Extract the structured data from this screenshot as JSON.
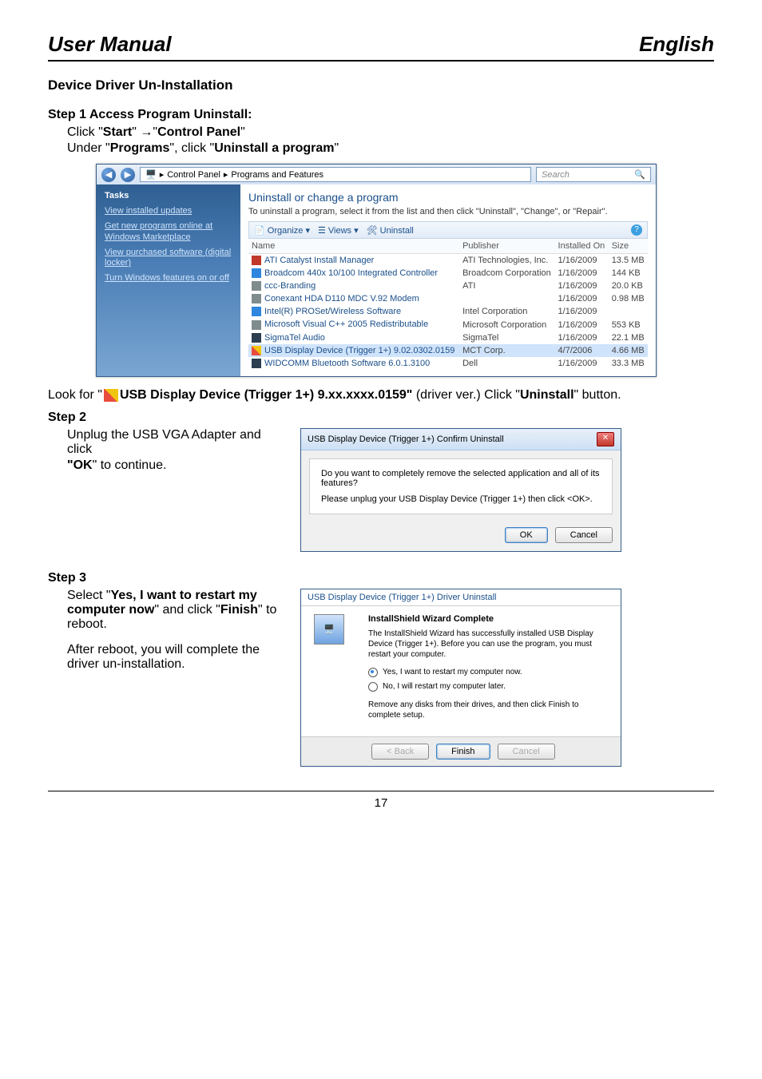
{
  "header": {
    "title": "User Manual",
    "lang": "English"
  },
  "section": {
    "title": "Device Driver Un-Installation"
  },
  "step1": {
    "title": "Step 1   Access Program Uninstall",
    "line1_pre": "Click \"",
    "start": "Start",
    "arrow": "\" →\"",
    "cp": "Control Panel",
    "quote": "\"",
    "line2_pre": "Under \"",
    "programs": "Programs",
    "line2_mid": "\", click \"",
    "uninstall_prog": "Uninstall a program",
    "line2_post": "\""
  },
  "cp_window": {
    "breadcrumb1": "Control Panel",
    "breadcrumb2": "Programs and Features",
    "search_placeholder": "Search",
    "sidebar": {
      "tasks": "Tasks",
      "views": "View installed updates",
      "getnew": "Get new programs online at Windows Marketplace",
      "purchased": "View purchased software (digital locker)",
      "turn": "Turn Windows features on or off"
    },
    "heading": "Uninstall or change a program",
    "sub": "To uninstall a program, select it from the list and then click \"Uninstall\", \"Change\", or \"Repair\".",
    "toolbar": {
      "organize": "Organize",
      "views": "Views",
      "uninstall": "Uninstall"
    },
    "cols": {
      "name": "Name",
      "publisher": "Publisher",
      "installed": "Installed On",
      "size": "Size"
    },
    "rows": [
      {
        "name": "ATI Catalyst Install Manager",
        "pub": "ATI Technologies, Inc.",
        "date": "1/16/2009",
        "size": "13.5 MB",
        "icon": "ico-red"
      },
      {
        "name": "Broadcom 440x 10/100 Integrated Controller",
        "pub": "Broadcom Corporation",
        "date": "1/16/2009",
        "size": "144 KB",
        "icon": "ico-blue"
      },
      {
        "name": "ccc-Branding",
        "pub": "ATI",
        "date": "1/16/2009",
        "size": "20.0 KB",
        "icon": "ico-gray"
      },
      {
        "name": "Conexant HDA D110 MDC V.92 Modem",
        "pub": "",
        "date": "1/16/2009",
        "size": "0.98 MB",
        "icon": "ico-gray"
      },
      {
        "name": "Intel(R) PROSet/Wireless Software",
        "pub": "Intel Corporation",
        "date": "1/16/2009",
        "size": "",
        "icon": "ico-blue"
      },
      {
        "name": "Microsoft Visual C++ 2005 Redistributable",
        "pub": "Microsoft Corporation",
        "date": "1/16/2009",
        "size": "553 KB",
        "icon": "ico-gray"
      },
      {
        "name": "SigmaTel Audio",
        "pub": "SigmaTel",
        "date": "1/16/2009",
        "size": "22.1 MB",
        "icon": "ico-bt"
      },
      {
        "name": "USB Display Device (Trigger 1+) 9.02.0302.0159",
        "pub": "MCT Corp.",
        "date": "4/7/2006",
        "size": "4.66 MB",
        "icon": "ico-usb",
        "sel": true
      },
      {
        "name": "WIDCOMM Bluetooth Software 6.0.1.3100",
        "pub": "Dell",
        "date": "1/16/2009",
        "size": "33.3 MB",
        "icon": "ico-bt"
      }
    ]
  },
  "lookfor": {
    "pre": "Look for \"",
    "bold1": "USB Display Device (Trigger 1+) 9.xx.xxxx.0159\"",
    "mid": " (driver ver.)   Click \"",
    "bold2": "Uninstall",
    "post": "\" button."
  },
  "step2": {
    "title": "Step 2",
    "line1": "Unplug the USB VGA Adapter and click",
    "ok_pre": "\"OK",
    "ok_post": "\" to continue."
  },
  "confirm_dialog": {
    "title": "USB Display Device (Trigger 1+) Confirm Uninstall",
    "line1": "Do you want to completely remove the selected application and all of its features?",
    "line2": "Please unplug your USB Display Device (Trigger 1+) then click <OK>.",
    "ok": "OK",
    "cancel": "Cancel"
  },
  "step3": {
    "title": "Step 3",
    "line1_pre": "Select \"",
    "bold1": "Yes, I want to restart my computer now",
    "line1_mid": "\" and click \"",
    "bold2": "Finish",
    "line1_post": "\" to reboot.",
    "line2": "After reboot, you will complete the driver un-installation."
  },
  "wizard": {
    "title": "USB Display Device (Trigger 1+) Driver Uninstall",
    "heading": "InstallShield Wizard Complete",
    "text": "The InstallShield Wizard has successfully installed USB Display Device (Trigger 1+). Before you can use the program, you must restart your computer.",
    "opt1": "Yes, I want to restart my computer now.",
    "opt2": "No, I will restart my computer later.",
    "hint": "Remove any disks from their drives, and then click Finish to complete setup.",
    "back": "< Back",
    "finish": "Finish",
    "cancel": "Cancel"
  },
  "page": "17"
}
